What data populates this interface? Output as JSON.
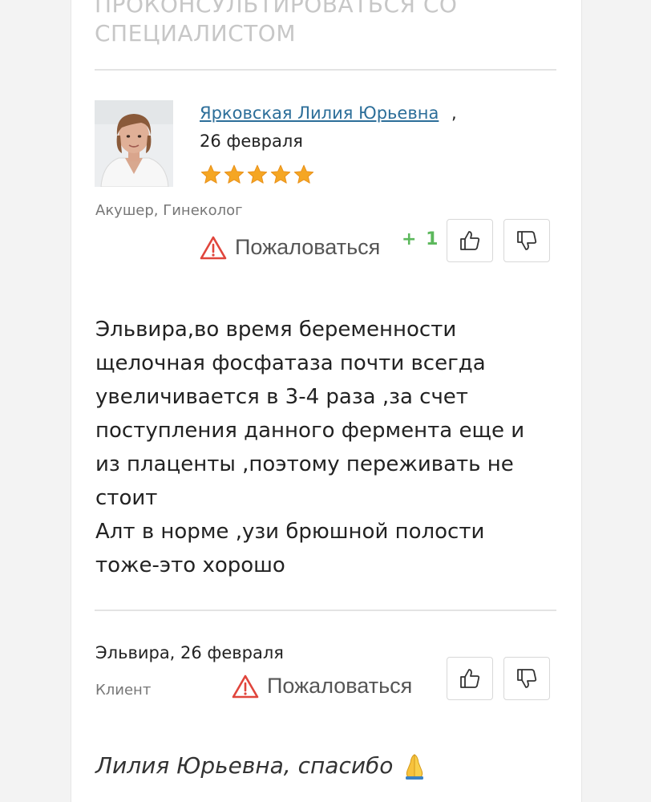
{
  "header": {
    "consult_line1": "Проконсультироваться со",
    "consult_line2": "специалистом"
  },
  "doctor_comment": {
    "author_name": "Ярковская Лилия Юрьевна",
    "comma": ",",
    "date": "26 февраля",
    "rating_stars": 5,
    "role": "Акушер, Гинеколог",
    "complain_label": "Пожаловаться",
    "likes": "+ 1",
    "text": "Эльвира,во время беременности\nщелочная фосфатаза почти всегда\nувеличивается в 3-4 раза ,за счет\nпоступления данного фермента еще и\nиз плаценты ,поэтому переживать не\nстоит\nАлт в норме ,узи брюшной полости\nтоже-это хорошо"
  },
  "client_comment": {
    "author_and_date": "Эльвира, 26 февраля",
    "role": "Клиент",
    "complain_label": "Пожаловаться",
    "text": "Лилия Юрьевна, спасибо"
  },
  "icons": {
    "warning": "warning-triangle-icon",
    "like": "thumbs-up-icon",
    "dislike": "thumbs-down-icon",
    "star": "star-icon",
    "emoji": "folded-hands-emoji"
  },
  "colors": {
    "link": "#2c6e99",
    "star": "#f5a623",
    "warning": "#e0453c",
    "plus": "#5cb85c",
    "muted": "#777777"
  }
}
